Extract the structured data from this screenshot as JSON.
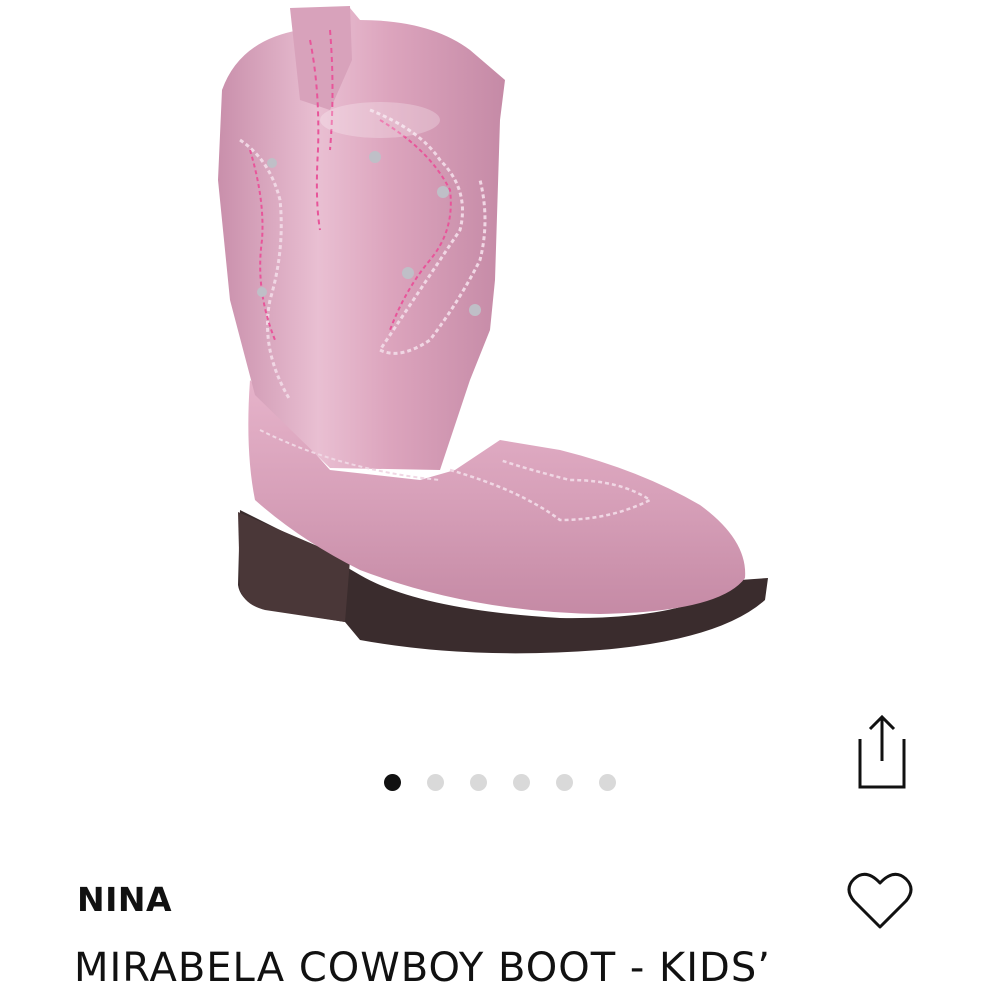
{
  "product": {
    "brand": "NINA",
    "title": "MIRABELA COWBOY BOOT - KIDS’",
    "image": {
      "subject": "pink metallic cowboy boot with embroidery",
      "primary_color": "#d9a3bb",
      "sole_color": "#3a2c2d",
      "stitch_color": "#f0d7e4",
      "accent_stitch_color": "#e8559a"
    }
  },
  "carousel": {
    "total": 6,
    "active_index": 0,
    "dots": [
      {
        "active": true
      },
      {
        "active": false
      },
      {
        "active": false
      },
      {
        "active": false
      },
      {
        "active": false
      },
      {
        "active": false
      }
    ]
  },
  "actions": {
    "share_icon": "share-icon",
    "wishlist_icon": "heart-icon"
  }
}
